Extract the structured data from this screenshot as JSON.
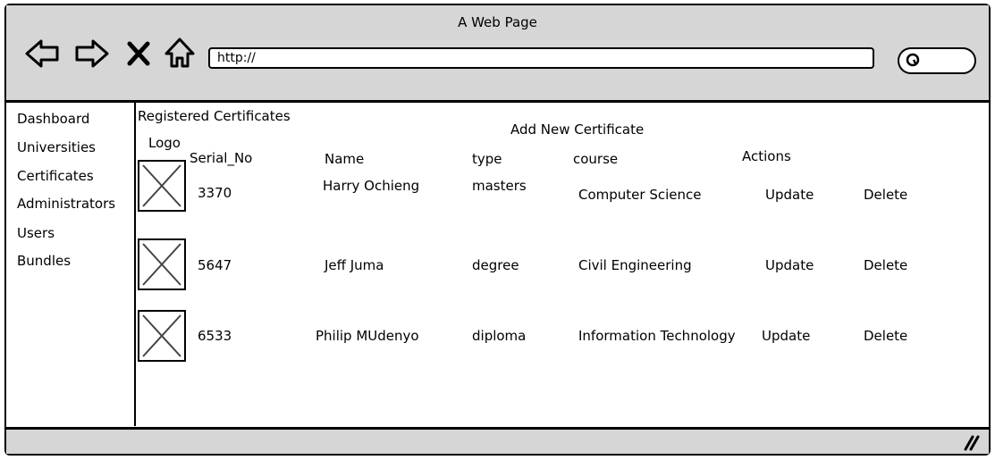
{
  "window": {
    "title": "A Web Page"
  },
  "toolbar": {
    "url": "http://",
    "icons": [
      "back-arrow-icon",
      "forward-arrow-icon",
      "close-icon",
      "home-icon",
      "search-icon"
    ]
  },
  "sidebar": {
    "items": [
      {
        "label": "Dashboard"
      },
      {
        "label": "Universities"
      },
      {
        "label": "Certificates"
      },
      {
        "label": "Administrators"
      },
      {
        "label": "Users"
      },
      {
        "label": "Bundles"
      }
    ]
  },
  "main": {
    "heading": "Registered Certificates",
    "add_link": "Add New Certificate",
    "columns": {
      "logo": "Logo",
      "serial": "Serial_No",
      "name": "Name",
      "type": "type",
      "course": "course",
      "actions": "Actions"
    },
    "rows": [
      {
        "serial": "3370",
        "name": "Harry Ochieng",
        "type": "masters",
        "course": "Computer Science",
        "update": "Update",
        "delete": "Delete"
      },
      {
        "serial": "5647",
        "name": "Jeff Juma",
        "type": "degree",
        "course": "Civil Engineering",
        "update": "Update",
        "delete": "Delete"
      },
      {
        "serial": "6533",
        "name": "Philip MUdenyo",
        "type": "diploma",
        "course": "Information Technology",
        "update": "Update",
        "delete": "Delete"
      }
    ]
  }
}
